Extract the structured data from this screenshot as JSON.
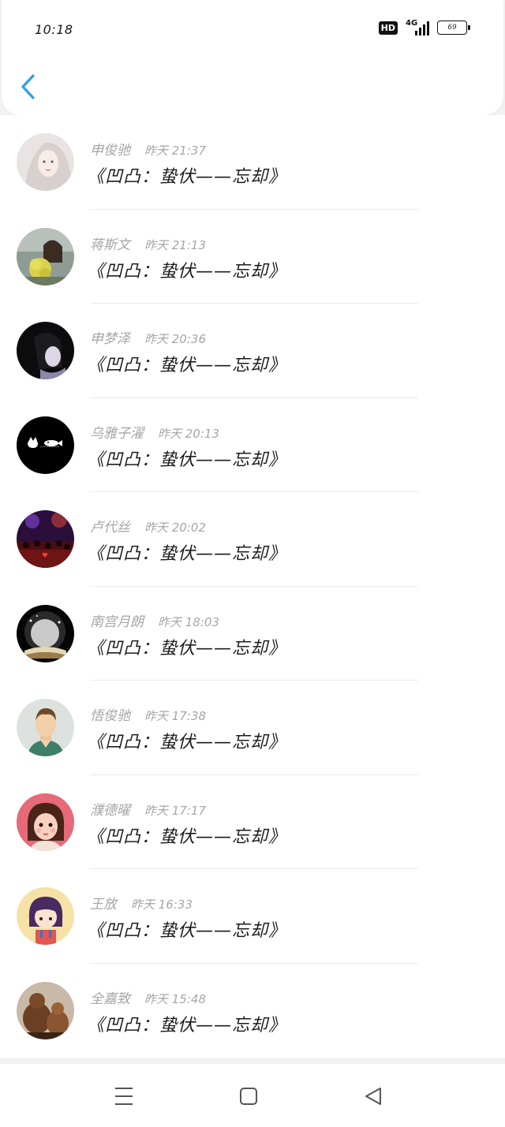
{
  "status_bar": {
    "time": "10:18",
    "hd_label": "HD",
    "network_label": "4G",
    "battery_level": "69"
  },
  "header": {
    "back_icon": "chevron-left-icon",
    "accent_color": "#2a9ff0"
  },
  "comments": [
    {
      "name": "申俊驰",
      "time": "昨天 21:37",
      "text": "《凹凸：蛰伏——忘却》",
      "avatar": "girl-portrait"
    },
    {
      "name": "蒋斯文",
      "time": "昨天 21:13",
      "text": "《凹凸：蛰伏——忘却》",
      "avatar": "girl-with-flowers"
    },
    {
      "name": "申梦泽",
      "time": "昨天 20:36",
      "text": "《凹凸：蛰伏——忘却》",
      "avatar": "dark-hair-girl"
    },
    {
      "name": "乌雅子濯",
      "time": "昨天 20:13",
      "text": "《凹凸：蛰伏——忘却》",
      "avatar": "black-cats"
    },
    {
      "name": "卢代丝",
      "time": "昨天 20:02",
      "text": "《凹凸：蛰伏——忘却》",
      "avatar": "concert-crowd"
    },
    {
      "name": "南宫月朗",
      "time": "昨天 18:03",
      "text": "《凹凸：蛰伏——忘却》",
      "avatar": "glowing-book"
    },
    {
      "name": "悟俊驰",
      "time": "昨天 17:38",
      "text": "《凹凸：蛰伏——忘却》",
      "avatar": "default-man"
    },
    {
      "name": "濮德曜",
      "time": "昨天 17:17",
      "text": "《凹凸：蛰伏——忘却》",
      "avatar": "cartoon-girl-pink"
    },
    {
      "name": "王放",
      "time": "昨天 16:33",
      "text": "《凹凸：蛰伏——忘却》",
      "avatar": "cartoon-girl-yellow"
    },
    {
      "name": "全嘉致",
      "time": "昨天 15:48",
      "text": "《凹凸：蛰伏——忘却》",
      "avatar": "bronze-figures"
    }
  ],
  "nav_bar": {
    "menu_icon": "menu-icon",
    "home_icon": "home-icon",
    "back_icon": "back-triangle-icon"
  }
}
